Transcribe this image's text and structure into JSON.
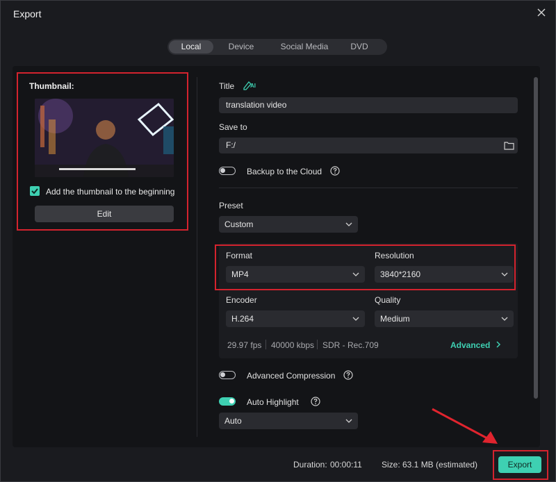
{
  "window": {
    "title": "Export"
  },
  "tabs": [
    {
      "label": "Local",
      "active": true
    },
    {
      "label": "Device",
      "active": false
    },
    {
      "label": "Social Media",
      "active": false
    },
    {
      "label": "DVD",
      "active": false
    }
  ],
  "thumbnail": {
    "label": "Thumbnail:",
    "add_to_beginning_label": "Add the thumbnail to the beginning",
    "add_to_beginning_checked": true,
    "edit_label": "Edit"
  },
  "title_field": {
    "label": "Title",
    "ai_badge": "AI",
    "value": "translation video"
  },
  "save_to": {
    "label": "Save to",
    "value": "F:/"
  },
  "backup": {
    "label": "Backup to the Cloud",
    "enabled": false
  },
  "preset": {
    "label": "Preset",
    "value": "Custom"
  },
  "format": {
    "label": "Format",
    "value": "MP4"
  },
  "resolution": {
    "label": "Resolution",
    "value": "3840*2160"
  },
  "encoder": {
    "label": "Encoder",
    "value": "H.264"
  },
  "quality": {
    "label": "Quality",
    "value": "Medium"
  },
  "specs": {
    "fps": "29.97 fps",
    "bitrate": "40000 kbps",
    "color": "SDR - Rec.709",
    "advanced_label": "Advanced"
  },
  "advanced_compression": {
    "label": "Advanced Compression",
    "enabled": false
  },
  "auto_highlight": {
    "label": "Auto Highlight",
    "enabled": true,
    "value": "Auto"
  },
  "footer": {
    "duration_label": "Duration:",
    "duration_value": "00:00:11",
    "size_label": "Size:",
    "size_value": "63.1 MB (estimated)",
    "export_label": "Export"
  },
  "colors": {
    "accent": "#3ed0b2",
    "highlight_border": "#d4232e",
    "background": "#1a1b1f"
  }
}
